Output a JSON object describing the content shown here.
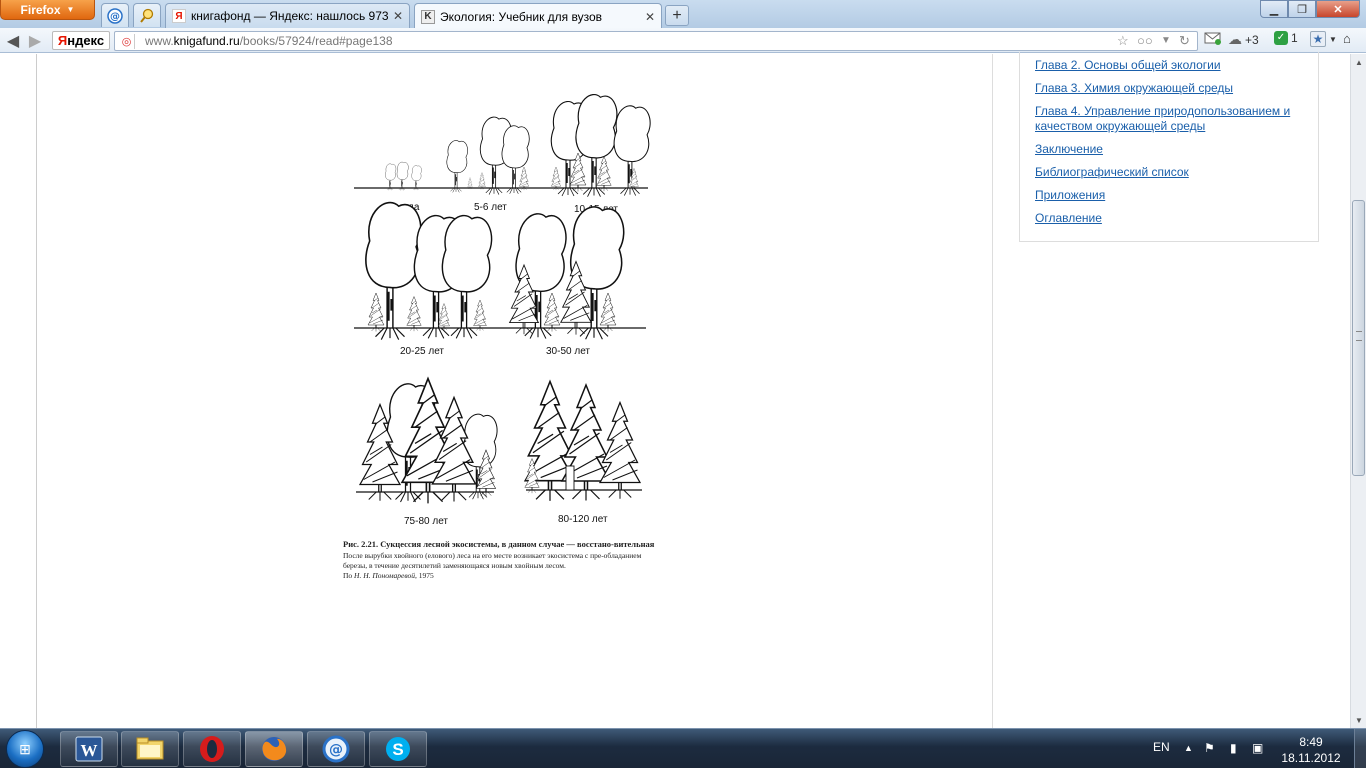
{
  "browser": {
    "menu_button": "Firefox",
    "tabs": [
      {
        "title": "книгафонд — Яндекс: нашлось 973 ...",
        "favicon": "Я"
      },
      {
        "title": "Экология: Учебник для вузов",
        "favicon": "K"
      }
    ],
    "address": {
      "prefix": "www.",
      "domain": "knigafund.ru",
      "path": "/books/57924/read#page138"
    },
    "search_brand": {
      "first": "Я",
      "rest": "ндекс"
    },
    "extra_badges": {
      "cloud": "+3",
      "notes": "1"
    }
  },
  "figure": {
    "stages": [
      "1-2 года",
      "5-6 лет",
      "10-15 лет",
      "20-25 лет",
      "30-50 лет",
      "75-80 лет",
      "80-120 лет"
    ],
    "caption_title": "Рис. 2.21. Сукцессия лесной экосистемы, в данном случае — восстано-вительная",
    "caption_body": "После вырубки хвойного (елового) леса на его месте возникает экосистема с пре-обладанием березы, в течение десятилетий заменяющаяся новым хвойным лесом.",
    "caption_author_prefix": "По ",
    "caption_author_name": "Н. Н. Пономаревой",
    "caption_author_year": ", 1975"
  },
  "toc": {
    "links": [
      "Глава 2. Основы общей экологии",
      "Глава 3. Химия окружающей среды",
      "Глава 4. Управление природопользованием и качеством окружающей среды",
      "Заключение",
      "Библиографический список",
      "Приложения",
      "Оглавление"
    ]
  },
  "taskbar": {
    "apps": [
      "word-icon",
      "explorer-icon",
      "opera-icon",
      "firefox-icon",
      "mail-icon",
      "skype-icon"
    ],
    "language": "EN",
    "time": "8:49",
    "date": "18.11.2012"
  },
  "colors": {
    "link": "#1a5faa",
    "firefox_orange": "#e0670f",
    "taskbar": "#1c2b3f"
  }
}
